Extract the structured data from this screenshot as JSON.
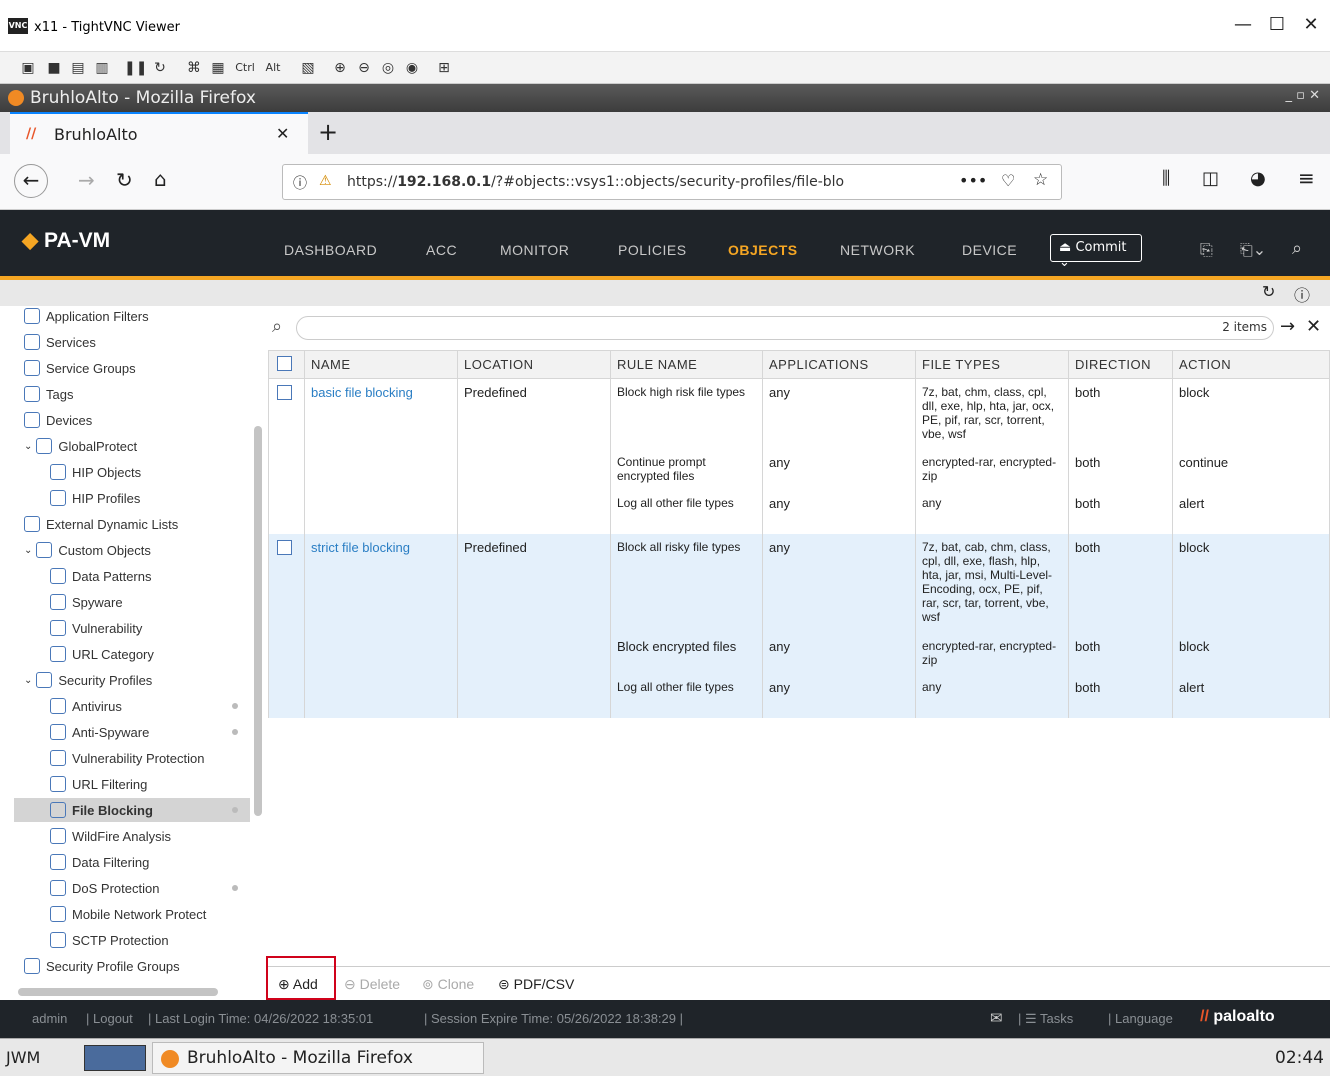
{
  "vnc": {
    "title": "x11 - TightVNC Viewer"
  },
  "firefox": {
    "window_title": "BruhloAlto - Mozilla Firefox",
    "tab_label": "BruhloAlto",
    "url_prefix": "https://",
    "url_host": "192.168.0.1",
    "url_path": "/?#objects::vsys1::objects/security-profiles/file-blo"
  },
  "pan": {
    "logo": "PA-VM",
    "nav": [
      "DASHBOARD",
      "ACC",
      "MONITOR",
      "POLICIES",
      "OBJECTS",
      "NETWORK",
      "DEVICE"
    ],
    "active_nav": "OBJECTS",
    "commit_label": "Commit"
  },
  "sidebar": {
    "items": [
      {
        "label": "Application Filters"
      },
      {
        "label": "Services"
      },
      {
        "label": "Service Groups"
      },
      {
        "label": "Tags"
      },
      {
        "label": "Devices"
      },
      {
        "label": "GlobalProtect"
      },
      {
        "label": "HIP Objects"
      },
      {
        "label": "HIP Profiles"
      },
      {
        "label": "External Dynamic Lists"
      },
      {
        "label": "Custom Objects"
      },
      {
        "label": "Data Patterns"
      },
      {
        "label": "Spyware"
      },
      {
        "label": "Vulnerability"
      },
      {
        "label": "URL Category"
      },
      {
        "label": "Security Profiles"
      },
      {
        "label": "Antivirus"
      },
      {
        "label": "Anti-Spyware"
      },
      {
        "label": "Vulnerability Protection"
      },
      {
        "label": "URL Filtering"
      },
      {
        "label": "File Blocking"
      },
      {
        "label": "WildFire Analysis"
      },
      {
        "label": "Data Filtering"
      },
      {
        "label": "DoS Protection"
      },
      {
        "label": "Mobile Network Protect"
      },
      {
        "label": "SCTP Protection"
      },
      {
        "label": "Security Profile Groups"
      }
    ]
  },
  "search": {
    "count": "2 items"
  },
  "table": {
    "headers": [
      "NAME",
      "LOCATION",
      "RULE NAME",
      "APPLICATIONS",
      "FILE TYPES",
      "DIRECTION",
      "ACTION"
    ],
    "rows": [
      {
        "name": "basic file blocking",
        "location": "Predefined",
        "rule": "Block high risk file types",
        "apps": "any",
        "types": "7z, bat, chm, class, cpl, dll, exe, hlp, hta, jar, ocx, PE, pif, rar, scr, torrent, vbe, wsf",
        "dir": "both",
        "action": "block"
      },
      {
        "name": "",
        "location": "",
        "rule": "Continue prompt encrypted files",
        "apps": "any",
        "types": "encrypted-rar, encrypted-zip",
        "dir": "both",
        "action": "continue"
      },
      {
        "name": "",
        "location": "",
        "rule": "Log all other file types",
        "apps": "any",
        "types": "any",
        "dir": "both",
        "action": "alert"
      },
      {
        "name": "strict file blocking",
        "location": "Predefined",
        "rule": "Block all risky file types",
        "apps": "any",
        "types": "7z, bat, cab, chm, class, cpl, dll, exe, flash, hlp, hta, jar, msi, Multi-Level-Encoding, ocx, PE, pif, rar, scr, tar, torrent, vbe, wsf",
        "dir": "both",
        "action": "block"
      },
      {
        "name": "",
        "location": "",
        "rule": "Block encrypted files",
        "apps": "any",
        "types": "encrypted-rar, encrypted-zip",
        "dir": "both",
        "action": "block"
      },
      {
        "name": "",
        "location": "",
        "rule": "Log all other file types",
        "apps": "any",
        "types": "any",
        "dir": "both",
        "action": "alert"
      }
    ]
  },
  "actions": {
    "add": "Add",
    "delete": "Delete",
    "clone": "Clone",
    "pdf": "PDF/CSV"
  },
  "status": {
    "user": "admin",
    "logout": "Logout",
    "last_login": "Last Login Time: 04/26/2022 18:35:01",
    "session": "Session Expire Time: 05/26/2022 18:38:29",
    "tasks": "Tasks",
    "language": "Language",
    "brand": "paloalto"
  },
  "taskbar": {
    "wm": "JWM",
    "app": "BruhloAlto - Mozilla Firefox",
    "clock": "02:44"
  }
}
